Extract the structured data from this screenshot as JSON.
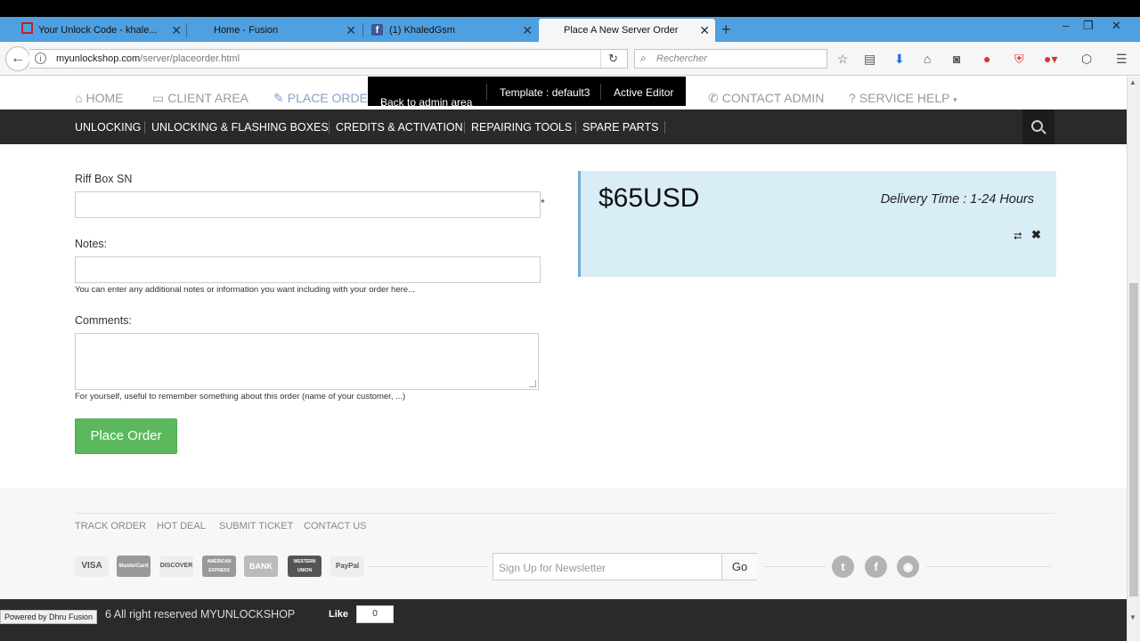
{
  "browser": {
    "tabs": [
      {
        "title": "Your Unlock Code - khale...",
        "active": false
      },
      {
        "title": "Home - Fusion",
        "active": false
      },
      {
        "title": "(1) KhaledGsm",
        "active": false
      },
      {
        "title": "Place A New Server Order",
        "active": true
      }
    ],
    "url_host": "myunlockshop.com",
    "url_path": "/server/placeorder.html",
    "search_placeholder": "Rechercher"
  },
  "header": {
    "nav": [
      "HOME",
      "CLIENT AREA",
      "PLACE ORDE",
      "CONTACT ADMIN",
      "SERVICE HELP"
    ],
    "admin_bar": {
      "back": "Back to admin area",
      "template": "Template : default3",
      "editor": "Active Editor"
    }
  },
  "categories": [
    "UNLOCKING",
    "UNLOCKING & FLASHING BOXES",
    "CREDITS & ACTIVATION",
    "REPAIRING TOOLS",
    "SPARE PARTS"
  ],
  "form": {
    "riff_label": "Riff Box SN",
    "riff_value": "",
    "required_mark": "*",
    "notes_label": "Notes:",
    "notes_value": "",
    "notes_help": "You can enter any additional notes or information you want including with your order here...",
    "comments_label": "Comments:",
    "comments_value": "",
    "comments_help": "For yourself, useful to remember something about this order (name of your customer, ...)",
    "submit": "Place Order"
  },
  "price_box": {
    "price": "$65USD",
    "delivery": "Delivery Time : 1-24 Hours"
  },
  "footer": {
    "links": [
      "TRACK ORDER",
      "HOT DEAL",
      "SUBMIT TICKET",
      "CONTACT US"
    ],
    "payments": [
      "VISA",
      "MasterCard",
      "DISCOVER",
      "AMERICAN EXPRESS",
      "BANK",
      "WESTERN UNION",
      "PayPal"
    ],
    "newsletter_placeholder": "Sign Up for Newsletter",
    "newsletter_button": "Go",
    "copyright": "6 All right reserved MYUNLOCKSHOP",
    "like": "Like",
    "like_count": "0",
    "powered": "Powered by Dhru Fusion"
  }
}
